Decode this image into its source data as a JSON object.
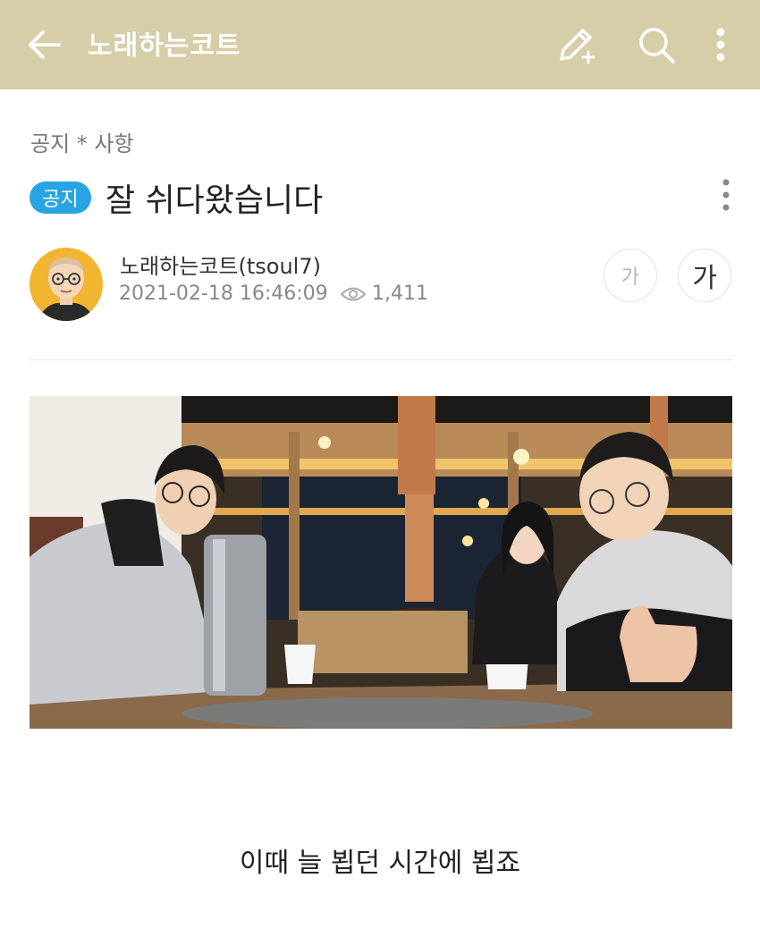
{
  "header": {
    "app_title": "노래하는코트",
    "icons": [
      "back-arrow-icon",
      "write-icon",
      "search-icon",
      "more-vertical-icon"
    ],
    "background_color": "#d6cda9"
  },
  "post": {
    "board_name": "공지 * 사항",
    "badge": "공지",
    "badge_color": "#29a4e3",
    "title": "잘 쉬다왔습니다",
    "author": "노래하는코트(tsoul7)",
    "date": "2021-02-18 16:46:09",
    "views": "1,411",
    "font_small_label": "가",
    "font_large_label": "가",
    "caption": "이때 늘 뵙던 시간에 뵙죠"
  }
}
